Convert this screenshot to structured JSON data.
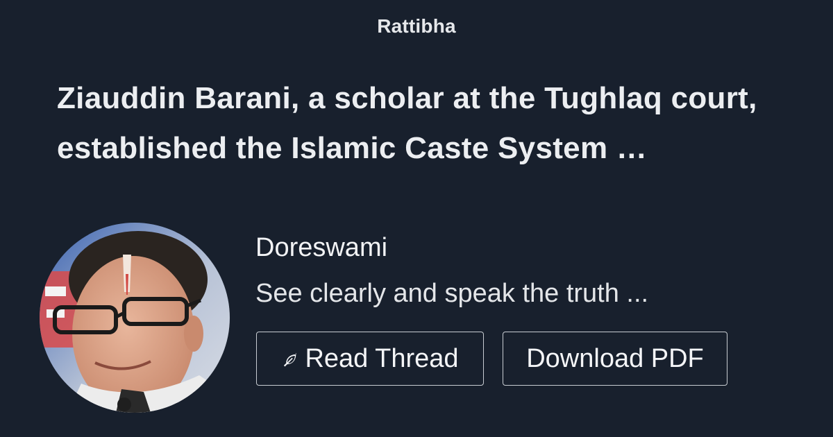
{
  "brand": "Rattibha",
  "title": "Ziauddin Barani, a scholar at the Tughlaq court, established the Islamic Caste System …",
  "author": {
    "name": "Doreswami",
    "bio": "See clearly and speak the truth ..."
  },
  "buttons": {
    "read_thread": "Read Thread",
    "download_pdf": "Download PDF",
    "read_icon": "feather-icon"
  },
  "colors": {
    "background": "#18202d",
    "text": "#eef0f3",
    "button_border": "#c9cdd3"
  }
}
